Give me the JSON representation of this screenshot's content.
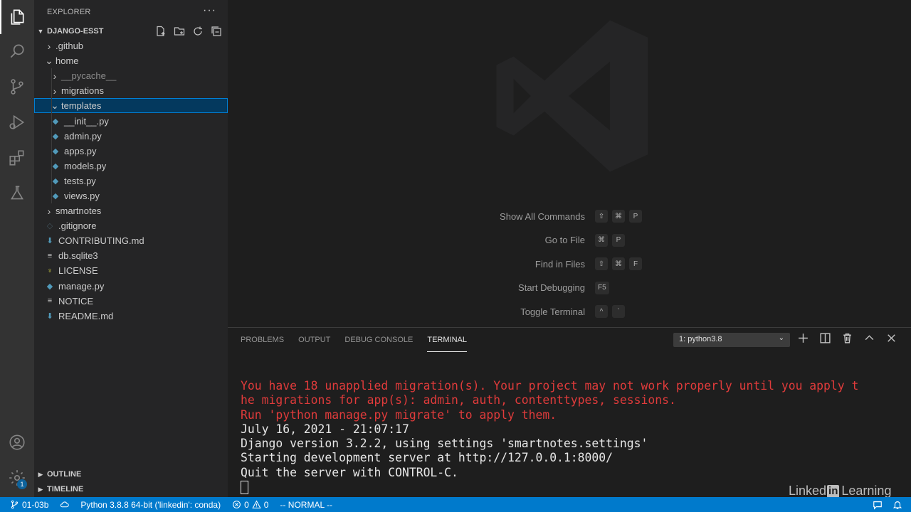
{
  "sidebar": {
    "title": "EXPLORER",
    "more": "···",
    "project": "DJANGO-ESST",
    "outline": "OUTLINE",
    "timeline": "TIMELINE",
    "tree": [
      {
        "label": ".github",
        "depth": 1,
        "kind": "folder",
        "open": false
      },
      {
        "label": "home",
        "depth": 1,
        "kind": "folder",
        "open": true
      },
      {
        "label": "__pycache__",
        "depth": 2,
        "kind": "folder",
        "open": false,
        "dim": true
      },
      {
        "label": "migrations",
        "depth": 2,
        "kind": "folder",
        "open": false
      },
      {
        "label": "templates",
        "depth": 2,
        "kind": "folder",
        "open": true,
        "selected": true
      },
      {
        "label": "__init__.py",
        "depth": 2,
        "kind": "py"
      },
      {
        "label": "admin.py",
        "depth": 2,
        "kind": "py"
      },
      {
        "label": "apps.py",
        "depth": 2,
        "kind": "py"
      },
      {
        "label": "models.py",
        "depth": 2,
        "kind": "py"
      },
      {
        "label": "tests.py",
        "depth": 2,
        "kind": "py"
      },
      {
        "label": "views.py",
        "depth": 2,
        "kind": "py"
      },
      {
        "label": "smartnotes",
        "depth": 1,
        "kind": "folder",
        "open": false
      },
      {
        "label": ".gitignore",
        "depth": 1,
        "kind": "git"
      },
      {
        "label": "CONTRIBUTING.md",
        "depth": 1,
        "kind": "md"
      },
      {
        "label": "db.sqlite3",
        "depth": 1,
        "kind": "txt"
      },
      {
        "label": "LICENSE",
        "depth": 1,
        "kind": "license"
      },
      {
        "label": "manage.py",
        "depth": 1,
        "kind": "py"
      },
      {
        "label": "NOTICE",
        "depth": 1,
        "kind": "txt"
      },
      {
        "label": "README.md",
        "depth": 1,
        "kind": "md"
      }
    ]
  },
  "activity": {
    "badge": "1"
  },
  "editor": {
    "shortcuts": [
      {
        "name": "Show All Commands",
        "keys": [
          "⇧",
          "⌘",
          "P"
        ]
      },
      {
        "name": "Go to File",
        "keys": [
          "⌘",
          "P"
        ]
      },
      {
        "name": "Find in Files",
        "keys": [
          "⇧",
          "⌘",
          "F"
        ]
      },
      {
        "name": "Start Debugging",
        "keys": [
          "F5"
        ]
      },
      {
        "name": "Toggle Terminal",
        "keys": [
          "^",
          "`"
        ]
      }
    ]
  },
  "panel": {
    "tabs": [
      "PROBLEMS",
      "OUTPUT",
      "DEBUG CONSOLE",
      "TERMINAL"
    ],
    "active_tab": "TERMINAL",
    "terminal_select": "1: python3.8",
    "terminal_lines": [
      {
        "text": "You have 18 unapplied migration(s). Your project may not work properly until you apply t",
        "color": "red"
      },
      {
        "text": "he migrations for app(s): admin, auth, contenttypes, sessions.",
        "color": "red"
      },
      {
        "text": "Run 'python manage.py migrate' to apply them.",
        "color": "red"
      },
      {
        "text": "July 16, 2021 - 21:07:17",
        "color": "white"
      },
      {
        "text": "Django version 3.2.2, using settings 'smartnotes.settings'",
        "color": "white"
      },
      {
        "text": "Starting development server at http://127.0.0.1:8000/",
        "color": "white"
      },
      {
        "text": "Quit the server with CONTROL-C.",
        "color": "white"
      }
    ]
  },
  "statusbar": {
    "branch": "01-03b",
    "python": "Python 3.8.8 64-bit ('linkedin': conda)",
    "errors": "0",
    "warnings": "0",
    "mode": "-- NORMAL --"
  },
  "watermark": {
    "linked": "Linked",
    "in": "in",
    "learning": "Learning"
  },
  "colors": {
    "accent": "#007acc",
    "selection": "#04395e",
    "error_text": "#e03b3b"
  }
}
